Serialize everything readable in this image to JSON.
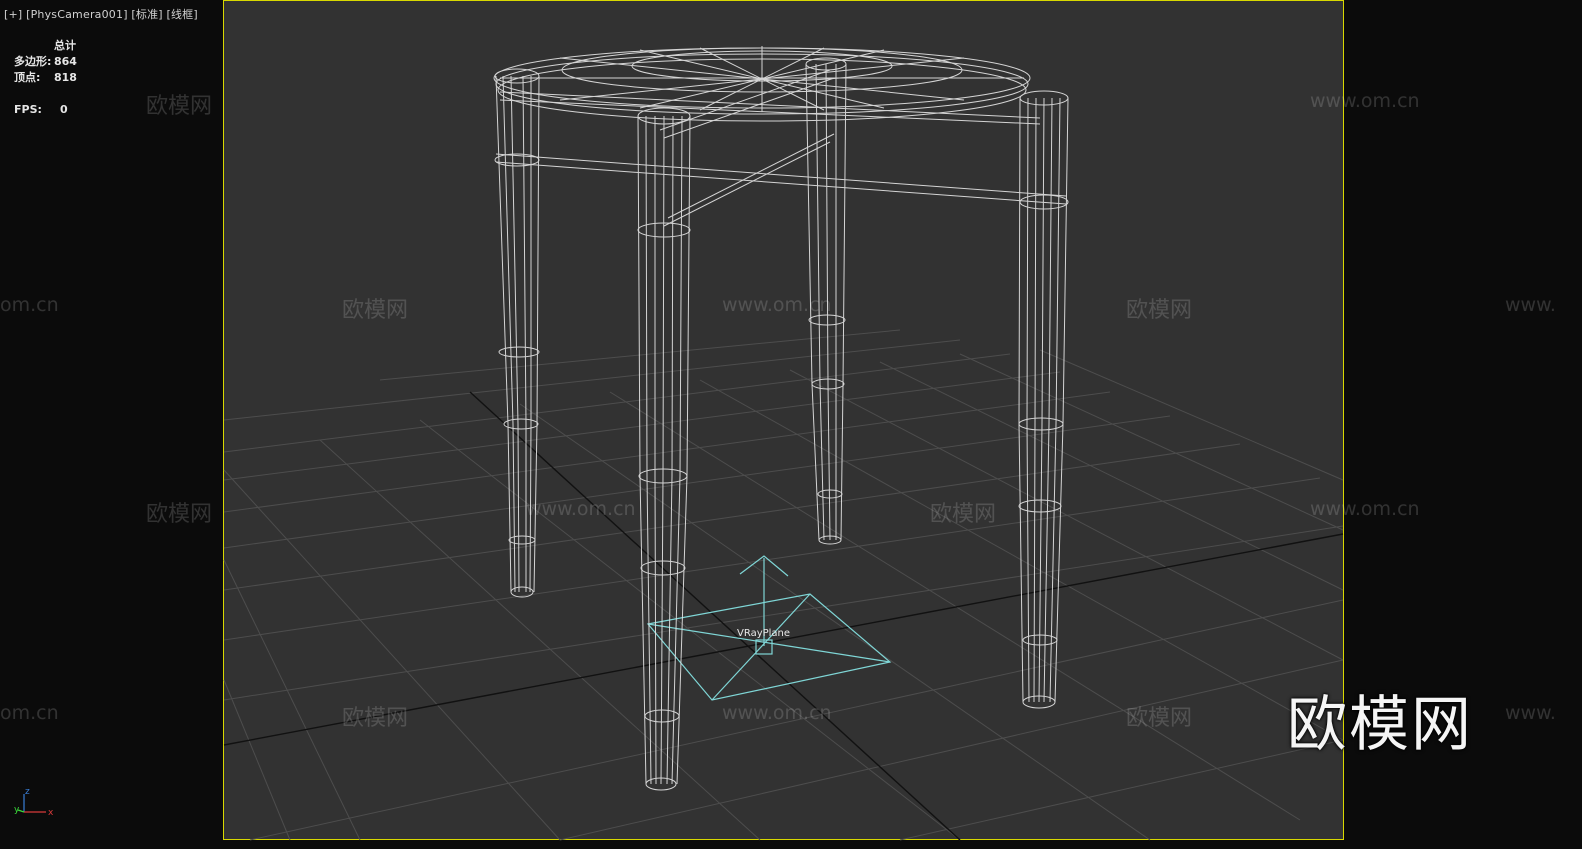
{
  "viewport": {
    "label": "[+]  [PhysCamera001]  [标准]  [线框]"
  },
  "stats": {
    "total_label": "总计",
    "polygons_label": "多边形:",
    "polygons_value": "864",
    "vertices_label": "顶点:",
    "vertices_value": "818",
    "fps_label": "FPS:",
    "fps_value": "0"
  },
  "scene": {
    "object_label": "VRayPlane",
    "wireframe_color": "#e8e8e8",
    "selection_color": "#7fd6d6",
    "grid_color": "#4a4a4a",
    "frame_color": "#d8d800"
  },
  "watermarks": {
    "brand_cn": "欧模网",
    "brand_url": "www.om.cn",
    "brand_url_partial_left": "om.cn",
    "brand_url_partial_right": "www.",
    "big_logo": "欧模网"
  },
  "axis_gizmo": {
    "z": "z",
    "x": "x",
    "y": "y"
  }
}
